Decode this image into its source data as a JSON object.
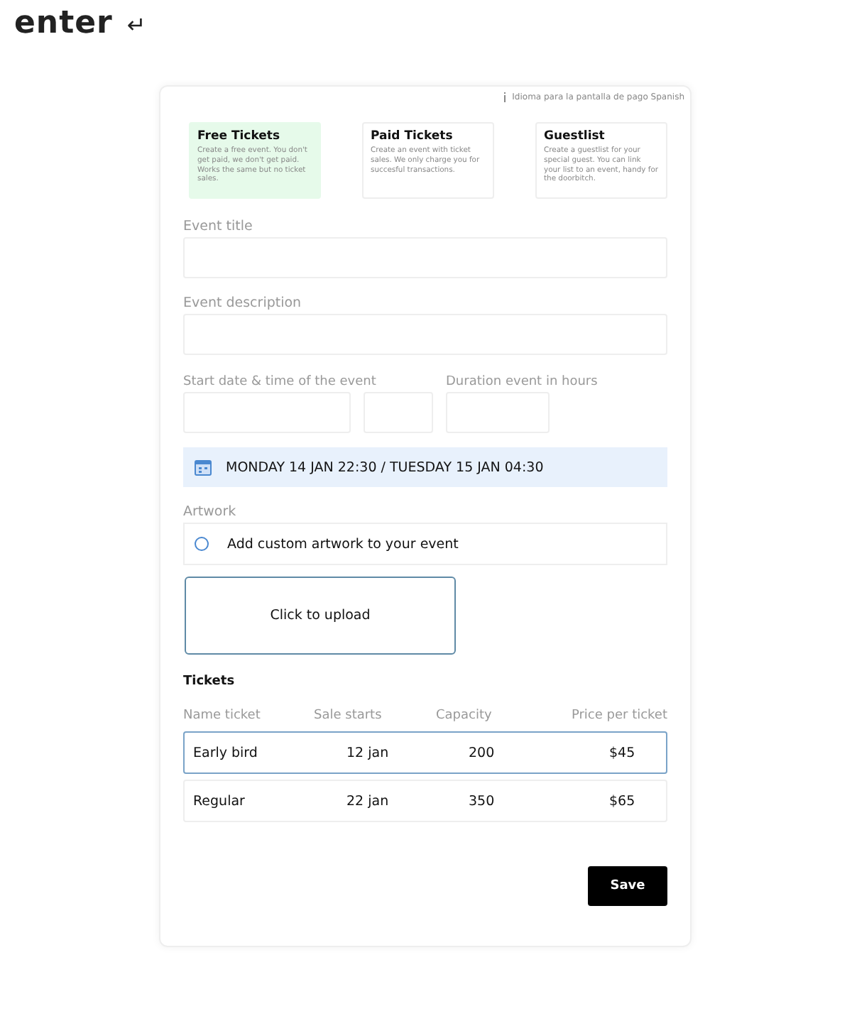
{
  "logo": {
    "text": "enter",
    "symbol": "↵"
  },
  "language_note": "Idioma para la pantalla de pago Spanish",
  "event_types": [
    {
      "title": "Free Tickets",
      "description": "Create a free event. You don't get paid, we don't get paid. Works the same but no ticket sales.",
      "selected": true
    },
    {
      "title": "Paid Tickets",
      "description": "Create an event with ticket sales. We only charge you for succesful transactions.",
      "selected": false
    },
    {
      "title": "Guestlist",
      "description": "Create a guestlist for your special guest. You can link your list to an event, handy for the doorbitch.",
      "selected": false
    }
  ],
  "event_title": {
    "label": "Event title"
  },
  "event_description": {
    "label": "Event description"
  },
  "start_label": "Start date & time of the event",
  "duration_label": "Duration event in hours",
  "date_summary": "MONDAY 14 JAN 22:30 / TUESDAY 15 JAN 04:30",
  "artwork": {
    "label": "Artwork",
    "option": "Add custom artwork to your event",
    "checked": false,
    "upload": "Click to upload"
  },
  "tickets": {
    "heading": "Tickets",
    "columns": [
      "Name ticket",
      "Sale starts",
      "Capacity",
      "Price per ticket"
    ],
    "rows": [
      {
        "cells": [
          "Early bird",
          "12 jan",
          "200",
          "$45"
        ],
        "selected": true
      },
      {
        "cells": [
          "Regular",
          "22 jan",
          "350",
          "$65"
        ],
        "selected": false
      }
    ]
  },
  "save_button": "Save"
}
